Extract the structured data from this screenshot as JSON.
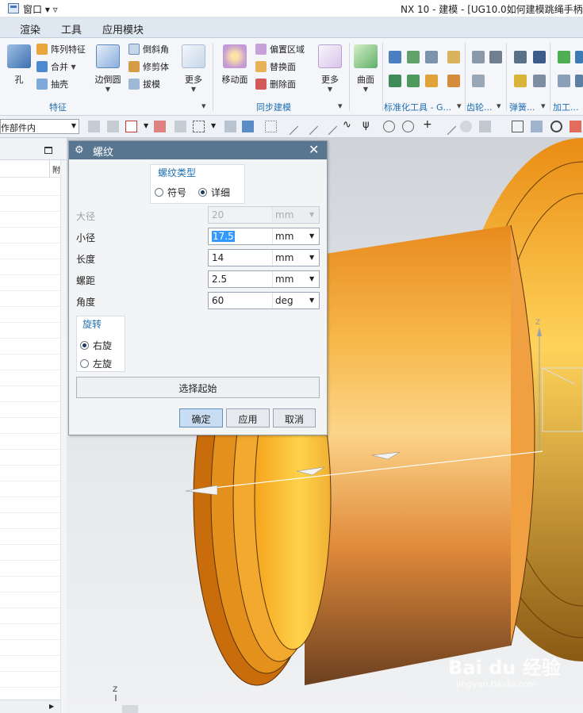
{
  "window": {
    "menu_label": "窗口",
    "title": "NX 10 - 建模 - [UG10.0如何建模跳绳手柄."
  },
  "tabs": [
    "渲染",
    "工具",
    "应用模块"
  ],
  "ribbon": {
    "feature_group": {
      "label": "特征",
      "hole": "孔",
      "pattern_feature": "阵列特征",
      "unite": "合并",
      "shell": "抽壳",
      "edge_blend": "边倒圆",
      "chamfer": "倒斜角",
      "trim_body": "修剪体",
      "draft": "拔模",
      "more": "更多"
    },
    "sync_group": {
      "label": "同步建模",
      "move_face": "移动面",
      "offset_region": "偏置区域",
      "replace_face": "替换面",
      "delete_face": "删除面",
      "more": "更多"
    },
    "surface_group": {
      "surface": "曲面"
    },
    "standard_tools_label": "标准化工具 - G...",
    "gear_label": "齿轮...",
    "spring_label": "弹簧...",
    "machining_label": "加工..."
  },
  "selection": {
    "scope": "作部件内"
  },
  "navigator": {
    "column_header": "附"
  },
  "dialog": {
    "title": "螺纹",
    "thread_type": {
      "title": "螺纹类型",
      "options": [
        "符号",
        "详细"
      ],
      "selected": "详细"
    },
    "fields": {
      "major_diameter": {
        "label": "大径",
        "value": "20",
        "unit": "mm"
      },
      "minor_diameter": {
        "label": "小径",
        "value": "17.5",
        "unit": "mm"
      },
      "length": {
        "label": "长度",
        "value": "14",
        "unit": "mm"
      },
      "pitch": {
        "label": "螺距",
        "value": "2.5",
        "unit": "mm"
      },
      "angle": {
        "label": "角度",
        "value": "60",
        "unit": "deg"
      }
    },
    "rotation": {
      "title": "旋转",
      "options": [
        "右旋",
        "左旋"
      ],
      "selected": "右旋"
    },
    "select_start": "选择起始",
    "buttons": {
      "ok": "确定",
      "apply": "应用",
      "cancel": "取消"
    }
  },
  "viewport": {
    "axis_z": "Z",
    "axis_z_bottom": "Z"
  },
  "watermark": {
    "brand": "Bai du 经验",
    "url": "jingyan.baidu.com"
  },
  "colors": {
    "dialog_title_bg": "#58768f",
    "accent_blue": "#1f6fb2",
    "part_orange": "#f2a43a"
  }
}
